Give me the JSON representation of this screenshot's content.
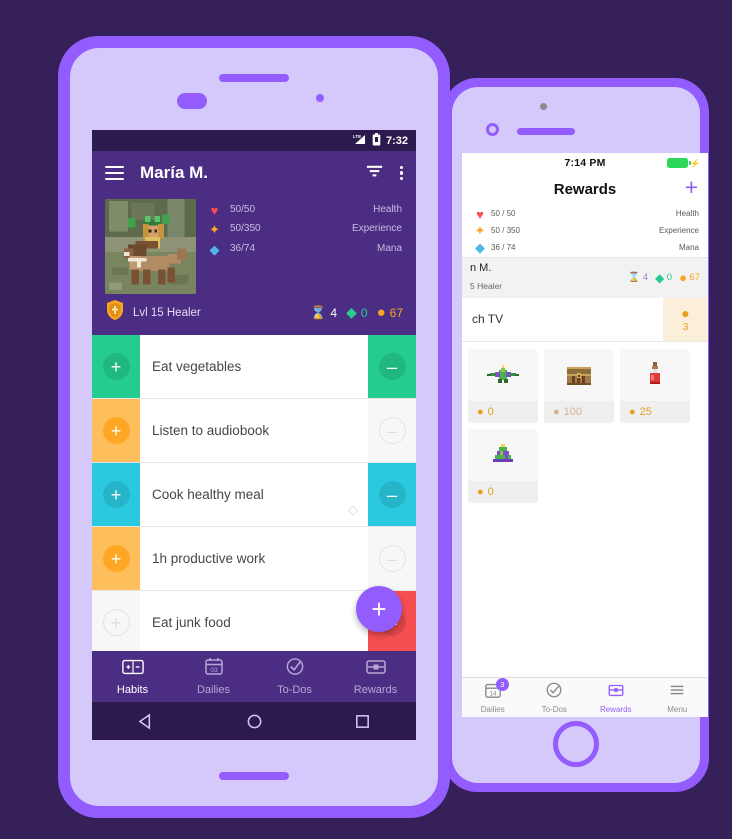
{
  "colors": {
    "background": "#36205A",
    "bezel": "#925CFF",
    "phone_body": "#D5C8FA",
    "android_purple": "#4B2E83",
    "android_statusbar": "#2C1A4D",
    "health": "#F74E52",
    "experience": "#FFA624",
    "mana": "#50B5E9",
    "green": "#24CC8F",
    "cyan": "#2BC9E0",
    "gold": "#F5A623"
  },
  "android": {
    "status_bar": {
      "time": "7:32",
      "signal_icon": "signal-icon",
      "battery_icon": "battery-icon"
    },
    "app_bar": {
      "menu_icon": "hamburger-icon",
      "title": "María M.",
      "filter_icon": "filter-icon",
      "overflow_icon": "overflow-menu-icon"
    },
    "avatar": {
      "name": "avatar-pixel-art"
    },
    "stats": [
      {
        "icon": "heart-icon",
        "glyph": "♥",
        "icon_color": "#F74E52",
        "value": "50/50",
        "label": "Health",
        "percent": 100,
        "color": "#F74E52"
      },
      {
        "icon": "star-icon",
        "glyph": "✦",
        "icon_color": "#FFA624",
        "value": "50/350",
        "label": "Experience",
        "percent": 14,
        "color": "#FFA624"
      },
      {
        "icon": "diamond-icon",
        "glyph": "◆",
        "icon_color": "#50B5E9",
        "value": "36/74",
        "label": "Mana",
        "percent": 49,
        "color": "#50B5E9"
      }
    ],
    "user": {
      "class_icon": "shield-icon",
      "level_text": "Lvl 15 Healer",
      "currencies": [
        {
          "icon": "hourglass-icon",
          "glyph": "⌛",
          "color": "#D5C8FA",
          "value": "4"
        },
        {
          "icon": "gem-icon",
          "glyph": "◆",
          "color": "#24CC8F",
          "value": "0"
        },
        {
          "icon": "gold-coin-icon",
          "glyph": "●",
          "color": "#F5A623",
          "value": "67"
        }
      ]
    },
    "tasks": [
      {
        "title": "Eat vegetables",
        "plus_color": "#24CC8F",
        "minus_color": "#24CC8F",
        "plus_active": true,
        "minus_active": true,
        "tag": false
      },
      {
        "title": "Listen to audiobook",
        "plus_color": "#FFA624",
        "minus_color": "",
        "plus_active": true,
        "minus_active": false,
        "tag": false
      },
      {
        "title": "Cook healthy meal",
        "plus_color": "#2BC9E0",
        "minus_color": "#2BC9E0",
        "plus_active": true,
        "minus_active": true,
        "tag": true
      },
      {
        "title": "1h productive work",
        "plus_color": "#FFA624",
        "minus_color": "",
        "plus_active": true,
        "minus_active": false,
        "tag": false
      },
      {
        "title": "Eat junk food",
        "plus_color": "",
        "minus_color": "#F74E52",
        "plus_active": false,
        "minus_active": true,
        "tag": false
      }
    ],
    "fab": {
      "label": "+",
      "icon": "add-task-fab-icon"
    },
    "tabs": [
      {
        "label": "Habits",
        "icon": "habits-icon",
        "active": true
      },
      {
        "label": "Dailies",
        "icon": "dailies-calendar-icon",
        "active": false,
        "day": "03"
      },
      {
        "label": "To-Dos",
        "icon": "todos-check-icon",
        "active": false
      },
      {
        "label": "Rewards",
        "icon": "rewards-chest-icon",
        "active": false
      }
    ],
    "nav_bar": [
      {
        "icon": "back-triangle-icon"
      },
      {
        "icon": "home-circle-icon"
      },
      {
        "icon": "recents-square-icon"
      }
    ]
  },
  "ios": {
    "status_bar": {
      "time": "7:14 PM",
      "battery_icon": "battery-charging-icon",
      "bolt": "⚡"
    },
    "nav": {
      "title": "Rewards",
      "add_icon": "add-reward-icon",
      "add_label": "+"
    },
    "stats": [
      {
        "icon": "heart-icon",
        "glyph": "♥",
        "icon_color": "#F74E52",
        "value": "50 / 50",
        "label": "Health",
        "percent": 100,
        "color": "#F74E52"
      },
      {
        "icon": "star-icon",
        "glyph": "✦",
        "icon_color": "#FFA624",
        "value": "50 / 350",
        "label": "Experience",
        "percent": 15,
        "color": "#FFBE5C"
      },
      {
        "icon": "diamond-icon",
        "glyph": "◆",
        "icon_color": "#50B5E9",
        "value": "36 / 74",
        "label": "Mana",
        "percent": 47,
        "color": "#3E9BE0"
      }
    ],
    "user": {
      "name": "n M.",
      "level_text": "5 Healer",
      "currencies": [
        {
          "icon": "hourglass-icon",
          "glyph": "⌛",
          "color": "#9B7FD4",
          "value": "4"
        },
        {
          "icon": "gem-icon",
          "glyph": "◆",
          "color": "#24CC8F",
          "value": "0"
        },
        {
          "icon": "gold-coin-icon",
          "glyph": "●",
          "color": "#F5A623",
          "value": "67"
        }
      ]
    },
    "custom_reward": {
      "title": "ch TV",
      "cost": "3",
      "coin_icon": "gold-coin-icon"
    },
    "reward_cards": [
      {
        "item": "armor-icon",
        "cost": "0",
        "dim": false
      },
      {
        "item": "chest-icon",
        "cost": "100",
        "dim": true
      },
      {
        "item": "health-potion-icon",
        "cost": "25",
        "dim": false
      },
      {
        "item": "hat-icon",
        "cost": "0",
        "dim": false
      }
    ],
    "tabs": [
      {
        "label": "Dailies",
        "icon": "dailies-calendar-icon",
        "active": false,
        "badge": "3",
        "day": "14"
      },
      {
        "label": "To-Dos",
        "icon": "todos-check-icon",
        "active": false
      },
      {
        "label": "Rewards",
        "icon": "rewards-chest-icon",
        "active": true
      },
      {
        "label": "Menu",
        "icon": "menu-lines-icon",
        "active": false
      }
    ],
    "home_button": {
      "icon": "home-button-icon"
    }
  }
}
